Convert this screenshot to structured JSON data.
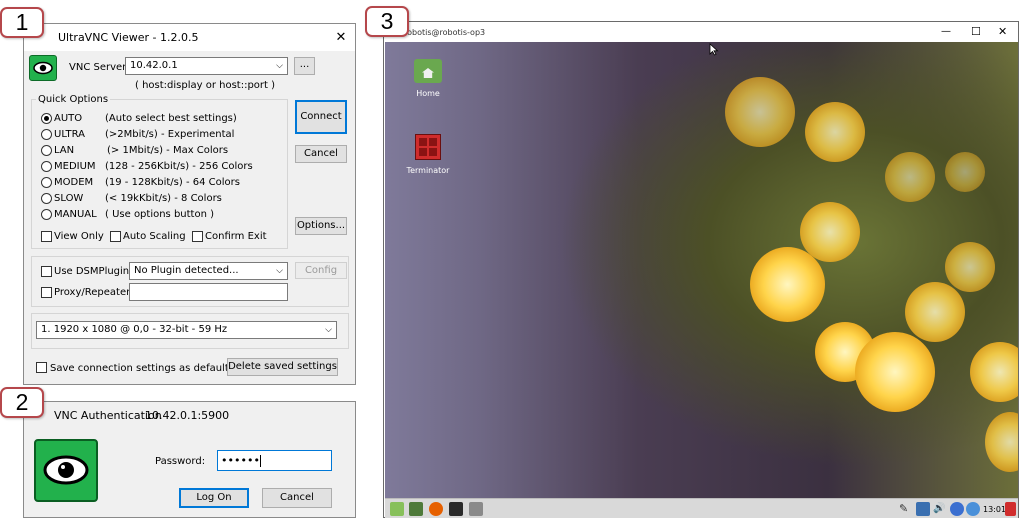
{
  "steps": [
    "1",
    "2",
    "3"
  ],
  "viewer": {
    "title": "UltraVNC Viewer - 1.2.0.5",
    "close": "✕",
    "server_label": "VNC Server:",
    "server_value": "10.42.0.1",
    "browse": "...",
    "hint": "( host:display or host::port )",
    "quick_options": "Quick Options",
    "options": [
      {
        "name": "AUTO",
        "desc": "(Auto select best settings)",
        "selected": true
      },
      {
        "name": "ULTRA",
        "desc": "(>2Mbit/s) - Experimental",
        "selected": false
      },
      {
        "name": "LAN",
        "desc": "(> 1Mbit/s) - Max Colors",
        "selected": false
      },
      {
        "name": "MEDIUM",
        "desc": "(128 - 256Kbit/s) - 256 Colors",
        "selected": false
      },
      {
        "name": "MODEM",
        "desc": "(19 - 128Kbit/s) - 64 Colors",
        "selected": false
      },
      {
        "name": "SLOW",
        "desc": "(< 19kKbit/s) - 8 Colors",
        "selected": false
      },
      {
        "name": "MANUAL",
        "desc": "( Use options button )",
        "selected": false
      }
    ],
    "view_only": "View Only",
    "auto_scaling": "Auto Scaling",
    "confirm_exit": "Confirm Exit",
    "connect": "Connect",
    "cancel": "Cancel",
    "options_btn": "Options...",
    "use_dsm": "Use DSMPlugin",
    "plugin_value": "No Plugin detected...",
    "config": "Config",
    "proxy": "Proxy/Repeater",
    "display": "1. 1920 x 1080 @ 0,0 - 32-bit - 59 Hz",
    "save_default": "Save connection settings as default",
    "delete_saved": "Delete saved settings"
  },
  "auth": {
    "title": "VNC Authentication",
    "host": "10.42.0.1:5900",
    "password_label": "Password:",
    "password_value": "••••••",
    "login": "Log On",
    "cancel": "Cancel"
  },
  "remote": {
    "title": "robotis@robotis-op3",
    "min": "—",
    "max": "☐",
    "close": "✕",
    "icons": [
      {
        "label": "Home"
      },
      {
        "label": "Terminator"
      }
    ],
    "clock": "13:01"
  },
  "colors": {
    "accent": "#0078d7",
    "badge_border": "#b5474b",
    "vnc_green": "#22b14c"
  }
}
